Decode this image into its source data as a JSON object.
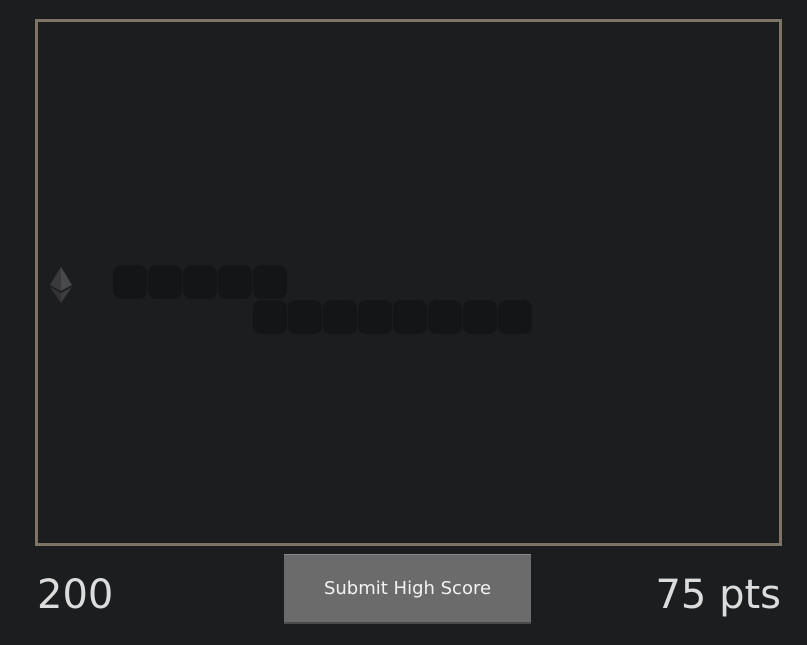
{
  "game": {
    "food_icon": "ethereum-icon",
    "snake_color": "#141517",
    "board_border_color": "#7d7466",
    "background_color": "#1c1d1f",
    "snake_cells": [
      [
        2,
        7
      ],
      [
        3,
        7
      ],
      [
        4,
        7
      ],
      [
        5,
        7
      ],
      [
        6,
        7
      ],
      [
        6,
        8
      ],
      [
        7,
        8
      ],
      [
        8,
        8
      ],
      [
        9,
        8
      ],
      [
        10,
        8
      ],
      [
        11,
        8
      ],
      [
        12,
        8
      ],
      [
        13,
        8
      ]
    ]
  },
  "footer": {
    "left_value": "200",
    "submit_label": "Submit High Score",
    "points_label": "75 pts"
  }
}
